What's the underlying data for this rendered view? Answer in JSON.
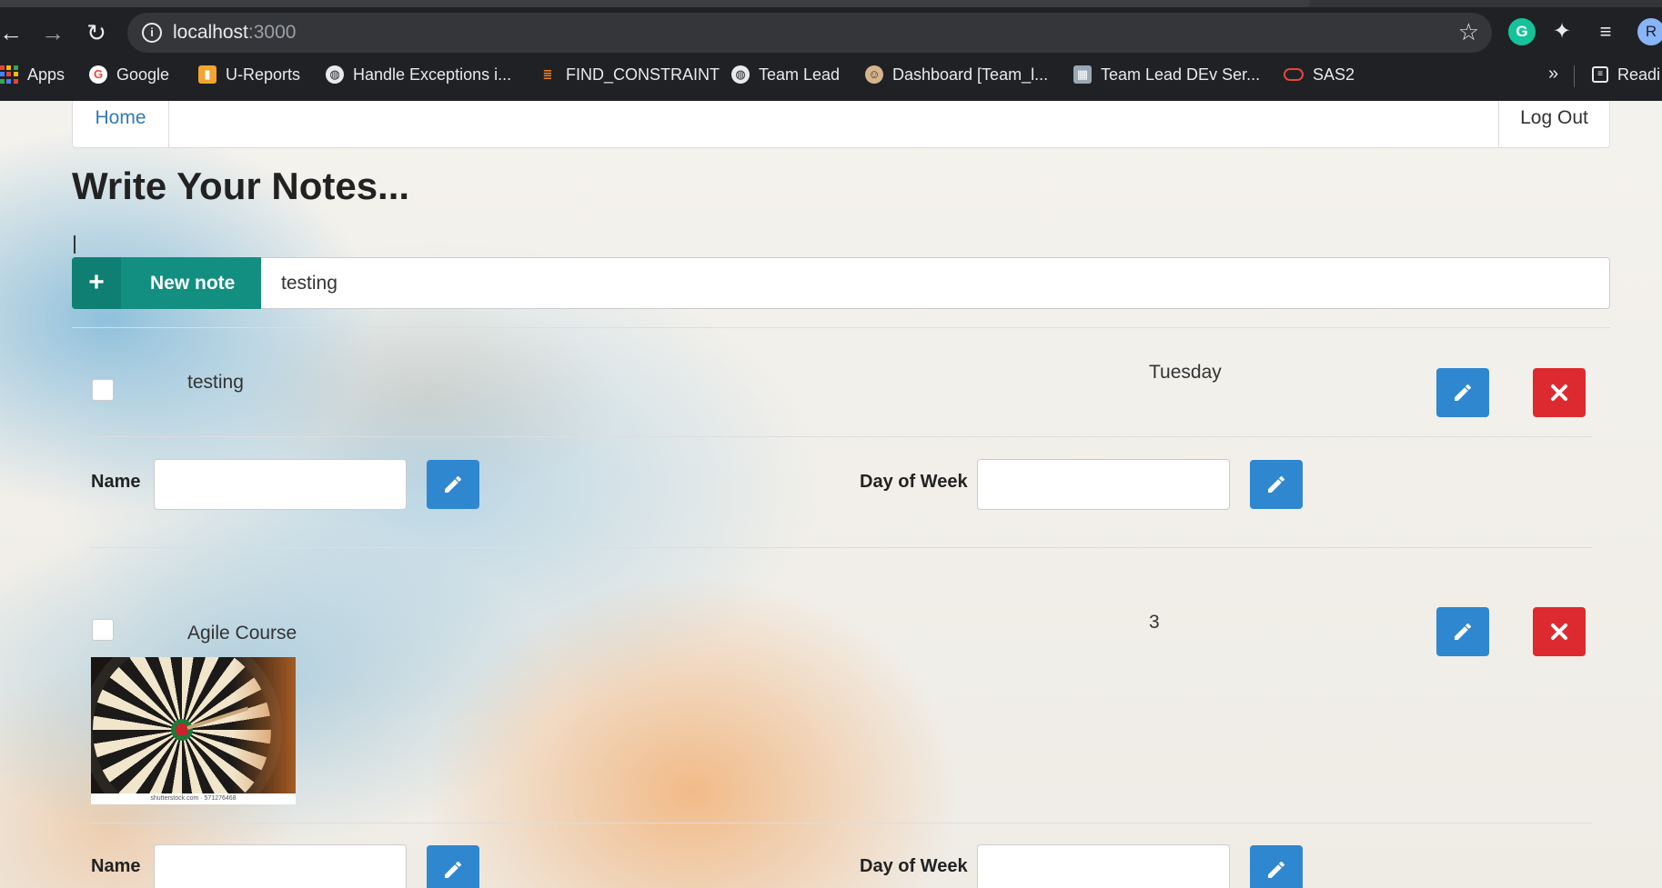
{
  "browser": {
    "url_host": "localhost",
    "url_port": ":3000",
    "avatar_letter": "R",
    "grammarly_letter": "G",
    "bookmarks": [
      {
        "label": "Apps",
        "icon": "apps-grid-icon"
      },
      {
        "label": "Google",
        "icon": "google-icon"
      },
      {
        "label": "U-Reports",
        "icon": "reports-icon"
      },
      {
        "label": "Handle Exceptions i...",
        "icon": "globe-icon"
      },
      {
        "label": "FIND_CONSTRAINT",
        "icon": "stackoverflow-icon"
      },
      {
        "label": "Team Lead",
        "icon": "globe-icon"
      },
      {
        "label": "Dashboard [Team_l...",
        "icon": "jenkins-icon"
      },
      {
        "label": "Team Lead DEv Ser...",
        "icon": "server-icon"
      },
      {
        "label": "SAS2",
        "icon": "oracle-icon"
      }
    ],
    "more_bookmarks": "»",
    "reading_list": "Readi"
  },
  "nav": {
    "home": "Home",
    "logout": "Log Out"
  },
  "page": {
    "title": "Write Your Notes...",
    "new_note_label": "New note",
    "new_note_input_value": "testing"
  },
  "notes": [
    {
      "text": "testing",
      "day": "Tuesday",
      "has_image": false
    },
    {
      "text": "Agile Course",
      "day": "3",
      "has_image": true,
      "image_caption": "shutterstock.com · 571276468"
    }
  ],
  "edit_form": {
    "name_label": "Name",
    "day_label": "Day of Week"
  },
  "colors": {
    "primary_teal": "#138f82",
    "edit_blue": "#2f87cf",
    "delete_red": "#dd2a31",
    "link_blue": "#337ab7"
  }
}
